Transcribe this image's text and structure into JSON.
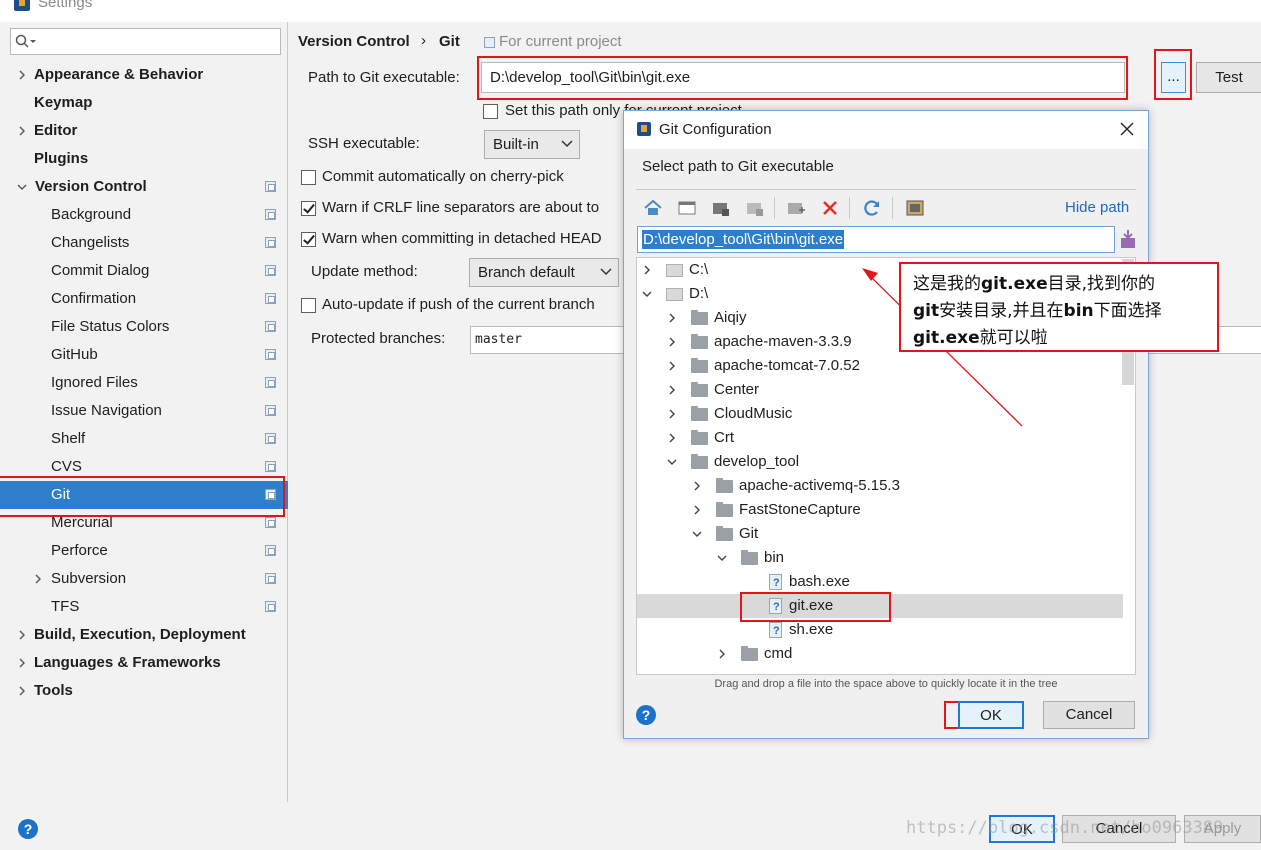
{
  "window": {
    "title": "Settings"
  },
  "sidebar": {
    "search_placeholder": "",
    "items": [
      {
        "label": "Appearance & Behavior",
        "bold": true,
        "arrow": "right",
        "indent": 0
      },
      {
        "label": "Keymap",
        "bold": true,
        "arrow": "none",
        "indent": 0
      },
      {
        "label": "Editor",
        "bold": true,
        "arrow": "right",
        "indent": 0
      },
      {
        "label": "Plugins",
        "bold": true,
        "arrow": "none",
        "indent": 0
      },
      {
        "label": "Version Control",
        "bold": true,
        "arrow": "down",
        "indent": 0,
        "project": true
      },
      {
        "label": "Background",
        "indent": 1,
        "project": true
      },
      {
        "label": "Changelists",
        "indent": 1,
        "project": true
      },
      {
        "label": "Commit Dialog",
        "indent": 1,
        "project": true
      },
      {
        "label": "Confirmation",
        "indent": 1,
        "project": true
      },
      {
        "label": "File Status Colors",
        "indent": 1,
        "project": true
      },
      {
        "label": "GitHub",
        "indent": 1,
        "project": true
      },
      {
        "label": "Ignored Files",
        "indent": 1,
        "project": true
      },
      {
        "label": "Issue Navigation",
        "indent": 1,
        "project": true
      },
      {
        "label": "Shelf",
        "indent": 1,
        "project": true
      },
      {
        "label": "CVS",
        "indent": 1,
        "project": true
      },
      {
        "label": "Git",
        "indent": 1,
        "project": true,
        "selected": true
      },
      {
        "label": "Mercurial",
        "indent": 1,
        "project": true
      },
      {
        "label": "Perforce",
        "indent": 1,
        "project": true
      },
      {
        "label": "Subversion",
        "indent": 1,
        "project": true,
        "arrow": "right"
      },
      {
        "label": "TFS",
        "indent": 1,
        "project": true
      },
      {
        "label": "Build, Execution, Deployment",
        "bold": true,
        "arrow": "right",
        "indent": 0
      },
      {
        "label": "Languages & Frameworks",
        "bold": true,
        "arrow": "right",
        "indent": 0
      },
      {
        "label": "Tools",
        "bold": true,
        "arrow": "right",
        "indent": 0
      }
    ]
  },
  "breadcrumb": {
    "section": "Version Control",
    "separator": "›",
    "page": "Git",
    "scope": "For current project"
  },
  "git_settings": {
    "path_label": "Path to Git executable:",
    "path_value": "D:\\develop_tool\\Git\\bin\\git.exe",
    "browse_label": "...",
    "test_label": "Test",
    "set_path_only": "Set this path only for current project",
    "ssh_label": "SSH executable:",
    "ssh_value": "Built-in",
    "cherry_pick": "Commit automatically on cherry-pick",
    "crlf_warn": "Warn if CRLF line separators are about to",
    "detached_warn": "Warn when committing in detached HEAD",
    "update_label": "Update method:",
    "update_value": "Branch default",
    "auto_update": "Auto-update if push of the current branch",
    "protected_label": "Protected branches:",
    "protected_value": "master"
  },
  "footer": {
    "help": "?",
    "ok": "OK",
    "cancel": "Cancel",
    "apply": "Apply"
  },
  "dialog": {
    "title": "Git Configuration",
    "subtitle": "Select path to Git executable",
    "hide_path": "Hide path",
    "path_value": "D:\\develop_tool\\Git\\bin\\git.exe",
    "drag_hint": "Drag and drop a file into the space above to quickly locate it in the tree",
    "help": "?",
    "ok": "OK",
    "cancel": "Cancel",
    "tree": [
      {
        "name": "C:\\",
        "type": "drive",
        "depth": 0,
        "expanded": false
      },
      {
        "name": "D:\\",
        "type": "drive",
        "depth": 0,
        "expanded": true
      },
      {
        "name": "Aiqiy",
        "type": "folder",
        "depth": 1,
        "expanded": false
      },
      {
        "name": "apache-maven-3.3.9",
        "type": "folder",
        "depth": 1,
        "expanded": false
      },
      {
        "name": "apache-tomcat-7.0.52",
        "type": "folder",
        "depth": 1,
        "expanded": false
      },
      {
        "name": "Center",
        "type": "folder",
        "depth": 1,
        "expanded": false
      },
      {
        "name": "CloudMusic",
        "type": "folder",
        "depth": 1,
        "expanded": false
      },
      {
        "name": "Crt",
        "type": "folder",
        "depth": 1,
        "expanded": false
      },
      {
        "name": "develop_tool",
        "type": "folder",
        "depth": 1,
        "expanded": true
      },
      {
        "name": "apache-activemq-5.15.3",
        "type": "folder",
        "depth": 2,
        "expanded": false
      },
      {
        "name": "FastStoneCapture",
        "type": "folder",
        "depth": 2,
        "expanded": false
      },
      {
        "name": "Git",
        "type": "folder",
        "depth": 2,
        "expanded": true
      },
      {
        "name": "bin",
        "type": "folder",
        "depth": 3,
        "expanded": true
      },
      {
        "name": "bash.exe",
        "type": "file",
        "depth": 4
      },
      {
        "name": "git.exe",
        "type": "file",
        "depth": 4,
        "selected": true
      },
      {
        "name": "sh.exe",
        "type": "file",
        "depth": 4
      },
      {
        "name": "cmd",
        "type": "folder",
        "depth": 3,
        "expanded": false
      }
    ]
  },
  "annotation": {
    "text_html": "这是我的<b>git.exe</b>目录,找到你的<br><b>git</b>安装目录,并且在<b>bin</b>下面选择<br><b>git.exe</b>就可以啦"
  },
  "watermark": "https://blog.csdn.net/ho0963389"
}
